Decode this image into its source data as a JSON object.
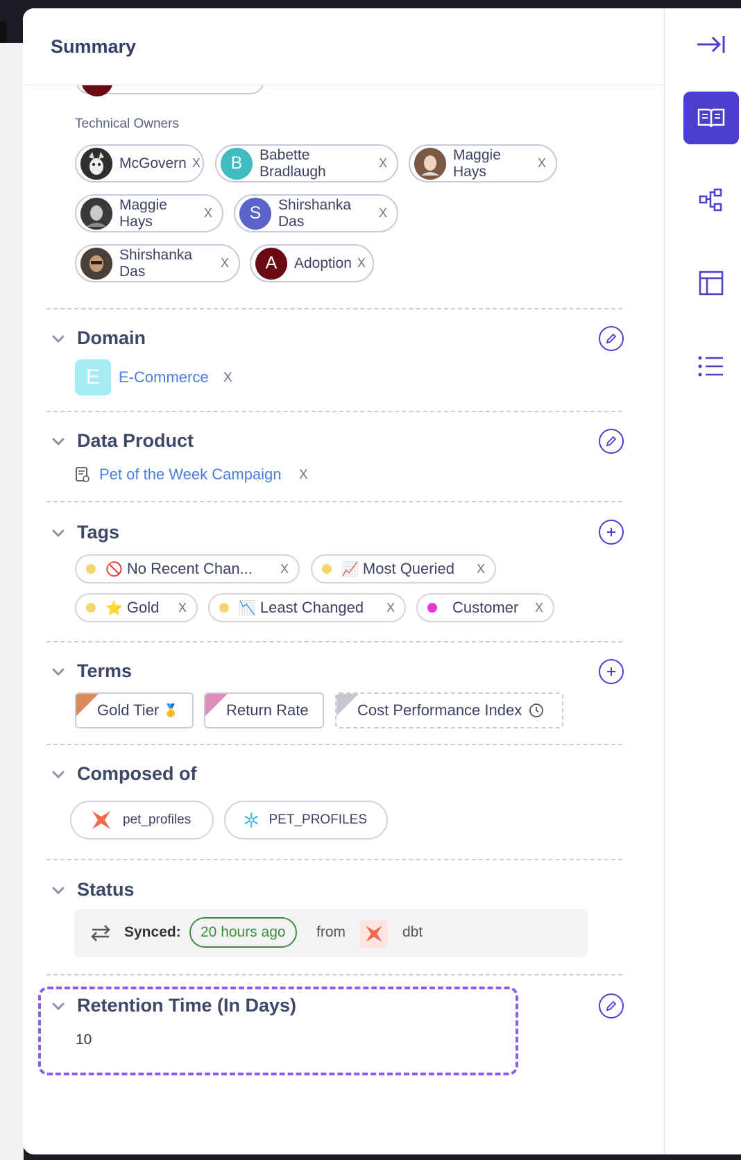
{
  "header": {
    "title": "Summary"
  },
  "owners": {
    "label": "Technical Owners",
    "chips": [
      {
        "name": "McGovern",
        "initial": "",
        "color": "#444444"
      },
      {
        "name": "Babette Bradlaugh",
        "initial": "B",
        "color": "#3ebcc0"
      },
      {
        "name": "Maggie Hays",
        "initial": "",
        "color": "#b08468"
      },
      {
        "name": "Maggie Hays",
        "initial": "",
        "color": "#555555"
      },
      {
        "name": "Shirshanka Das",
        "initial": "S",
        "color": "#5a63c8"
      },
      {
        "name": "Shirshanka Das",
        "initial": "",
        "color": "#6b5a4a"
      },
      {
        "name": "Adoption",
        "initial": "A",
        "color": "#6a0b14"
      }
    ],
    "remove_glyph": "X"
  },
  "domain": {
    "title": "Domain",
    "value": "E-Commerce",
    "initial": "E",
    "color": "#a6ecf5"
  },
  "data_product": {
    "title": "Data Product",
    "value": "Pet of the Week Campaign"
  },
  "tags": {
    "title": "Tags",
    "items": [
      {
        "label": "No Recent Chan...",
        "emoji": "🚫",
        "dot": "#f3d56b"
      },
      {
        "label": "Most Queried",
        "emoji": "📈",
        "dot": "#f3d56b"
      },
      {
        "label": "Gold",
        "emoji": "⭐",
        "dot": "#f3d56b"
      },
      {
        "label": "Least Changed",
        "emoji": "📉",
        "dot": "#f3d56b"
      },
      {
        "label": "Customer",
        "emoji": "",
        "dot": "#e23ad6"
      }
    ]
  },
  "terms": {
    "title": "Terms",
    "items": [
      {
        "label": "Gold Tier",
        "suffix": "🥇",
        "color": "#d98a5b"
      },
      {
        "label": "Return Rate",
        "suffix": "",
        "color": "#d98fb7"
      },
      {
        "label": "Cost Performance Index",
        "suffix": "",
        "color": "#c5c8d2"
      }
    ]
  },
  "composed_of": {
    "title": "Composed of",
    "items": [
      {
        "label": "pet_profiles",
        "icon": "dbt-icon"
      },
      {
        "label": "PET_PROFILES",
        "icon": "snowflake-icon"
      }
    ]
  },
  "status": {
    "title": "Status",
    "synced_label": "Synced:",
    "time": "20 hours ago",
    "from": "from",
    "source": "dbt"
  },
  "retention": {
    "title": "Retention Time (In Days)",
    "value": "10"
  },
  "colors": {
    "accent": "#4c3ecf",
    "link": "#4a7de0",
    "highlight": "#8a5cf0",
    "synced_green": "#3e8e3e"
  }
}
